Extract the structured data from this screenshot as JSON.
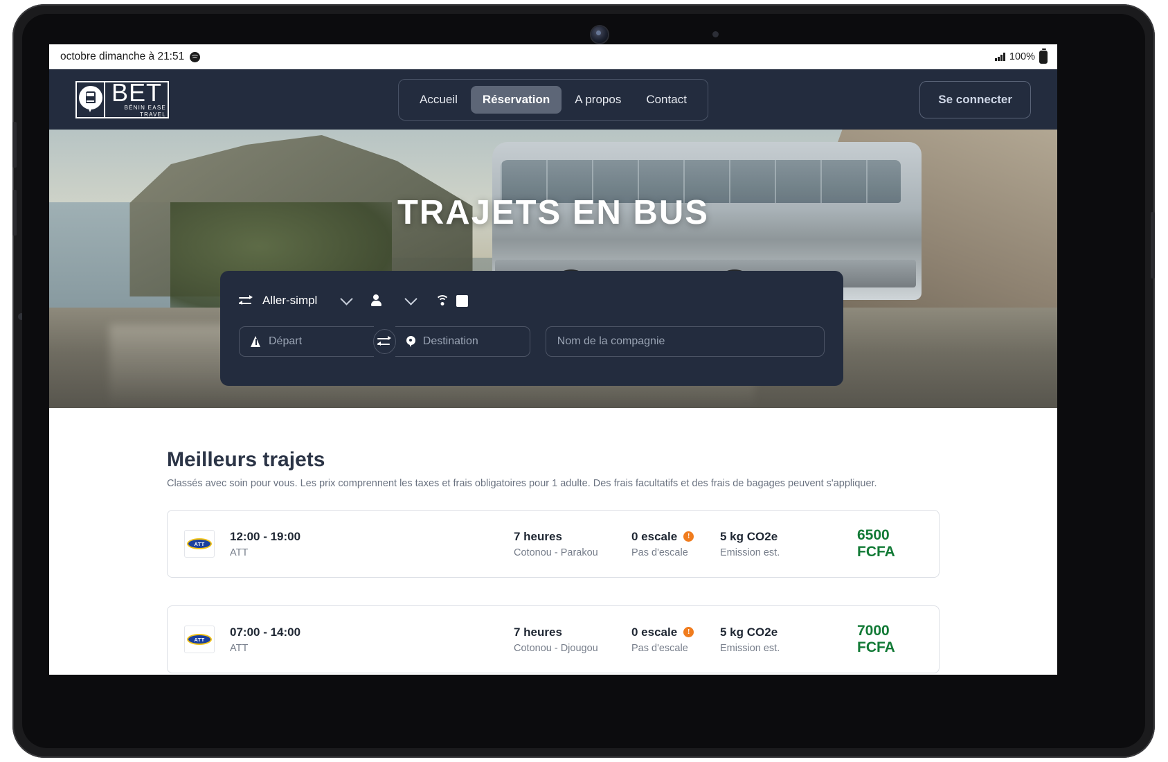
{
  "status_bar": {
    "datetime": "octobre dimanche à 21:51",
    "media_icon": "spotify-icon",
    "signal_icon": "signal-bars-icon",
    "battery_percent": "100%",
    "battery_icon": "battery-full-icon"
  },
  "header": {
    "logo": {
      "mark_icon": "bus-map-pin-icon",
      "name": "BET",
      "tagline": "BÉNIN EASE TRAVEL"
    },
    "nav": [
      {
        "label": "Accueil",
        "active": false
      },
      {
        "label": "Réservation",
        "active": true
      },
      {
        "label": "A propos",
        "active": false
      },
      {
        "label": "Contact",
        "active": false
      }
    ],
    "login_label": "Se connecter",
    "background_color": "#232c3e"
  },
  "hero": {
    "title": "TRAJETS EN BUS"
  },
  "search_panel": {
    "trip_type": {
      "icon": "swap-arrows-icon",
      "value": "Aller-simpl",
      "chevron_icon": "chevron-down-icon"
    },
    "passengers": {
      "icon": "person-icon",
      "chevron_icon": "chevron-down-icon"
    },
    "amenities": {
      "wifi_icon": "wifi-icon",
      "checkbox_icon": "checkbox-filled-icon"
    },
    "departure": {
      "icon": "road-icon",
      "placeholder": "Départ",
      "value": ""
    },
    "swap_button_icon": "swap-arrows-icon",
    "destination": {
      "icon": "map-pin-icon",
      "placeholder": "Destination",
      "value": ""
    },
    "company": {
      "placeholder": "Nom de la compagnie",
      "value": ""
    }
  },
  "results": {
    "title": "Meilleurs trajets",
    "subtitle": "Classés avec soin pour vous. Les prix comprennent les taxes et frais obligatoires pour 1 adulte. Des frais facultatifs et des frais de bagages peuvent s'appliquer.",
    "trips": [
      {
        "carrier_logo": "att-logo-icon",
        "times": "12:00 - 19:00",
        "carrier": "ATT",
        "duration": "7 heures",
        "route": "Cotonou - Parakou",
        "stops": "0 escale",
        "stops_icon": "info-badge-icon",
        "stops_sub": "Pas d'escale",
        "co2": "5 kg CO2e",
        "co2_sub": "Emission est.",
        "price": "6500 FCFA"
      },
      {
        "carrier_logo": "att-logo-icon",
        "times": "07:00 - 14:00",
        "carrier": "ATT",
        "duration": "7 heures",
        "route": "Cotonou - Djougou",
        "stops": "0 escale",
        "stops_icon": "info-badge-icon",
        "stops_sub": "Pas d'escale",
        "co2": "5 kg CO2e",
        "co2_sub": "Emission est.",
        "price": "7000 FCFA"
      }
    ]
  },
  "colors": {
    "header_navy": "#232c3e",
    "price_green": "#127a36",
    "badge_orange": "#f07c1e",
    "carrier_blue": "#1a3f9e",
    "carrier_yellow": "#f2c317"
  }
}
